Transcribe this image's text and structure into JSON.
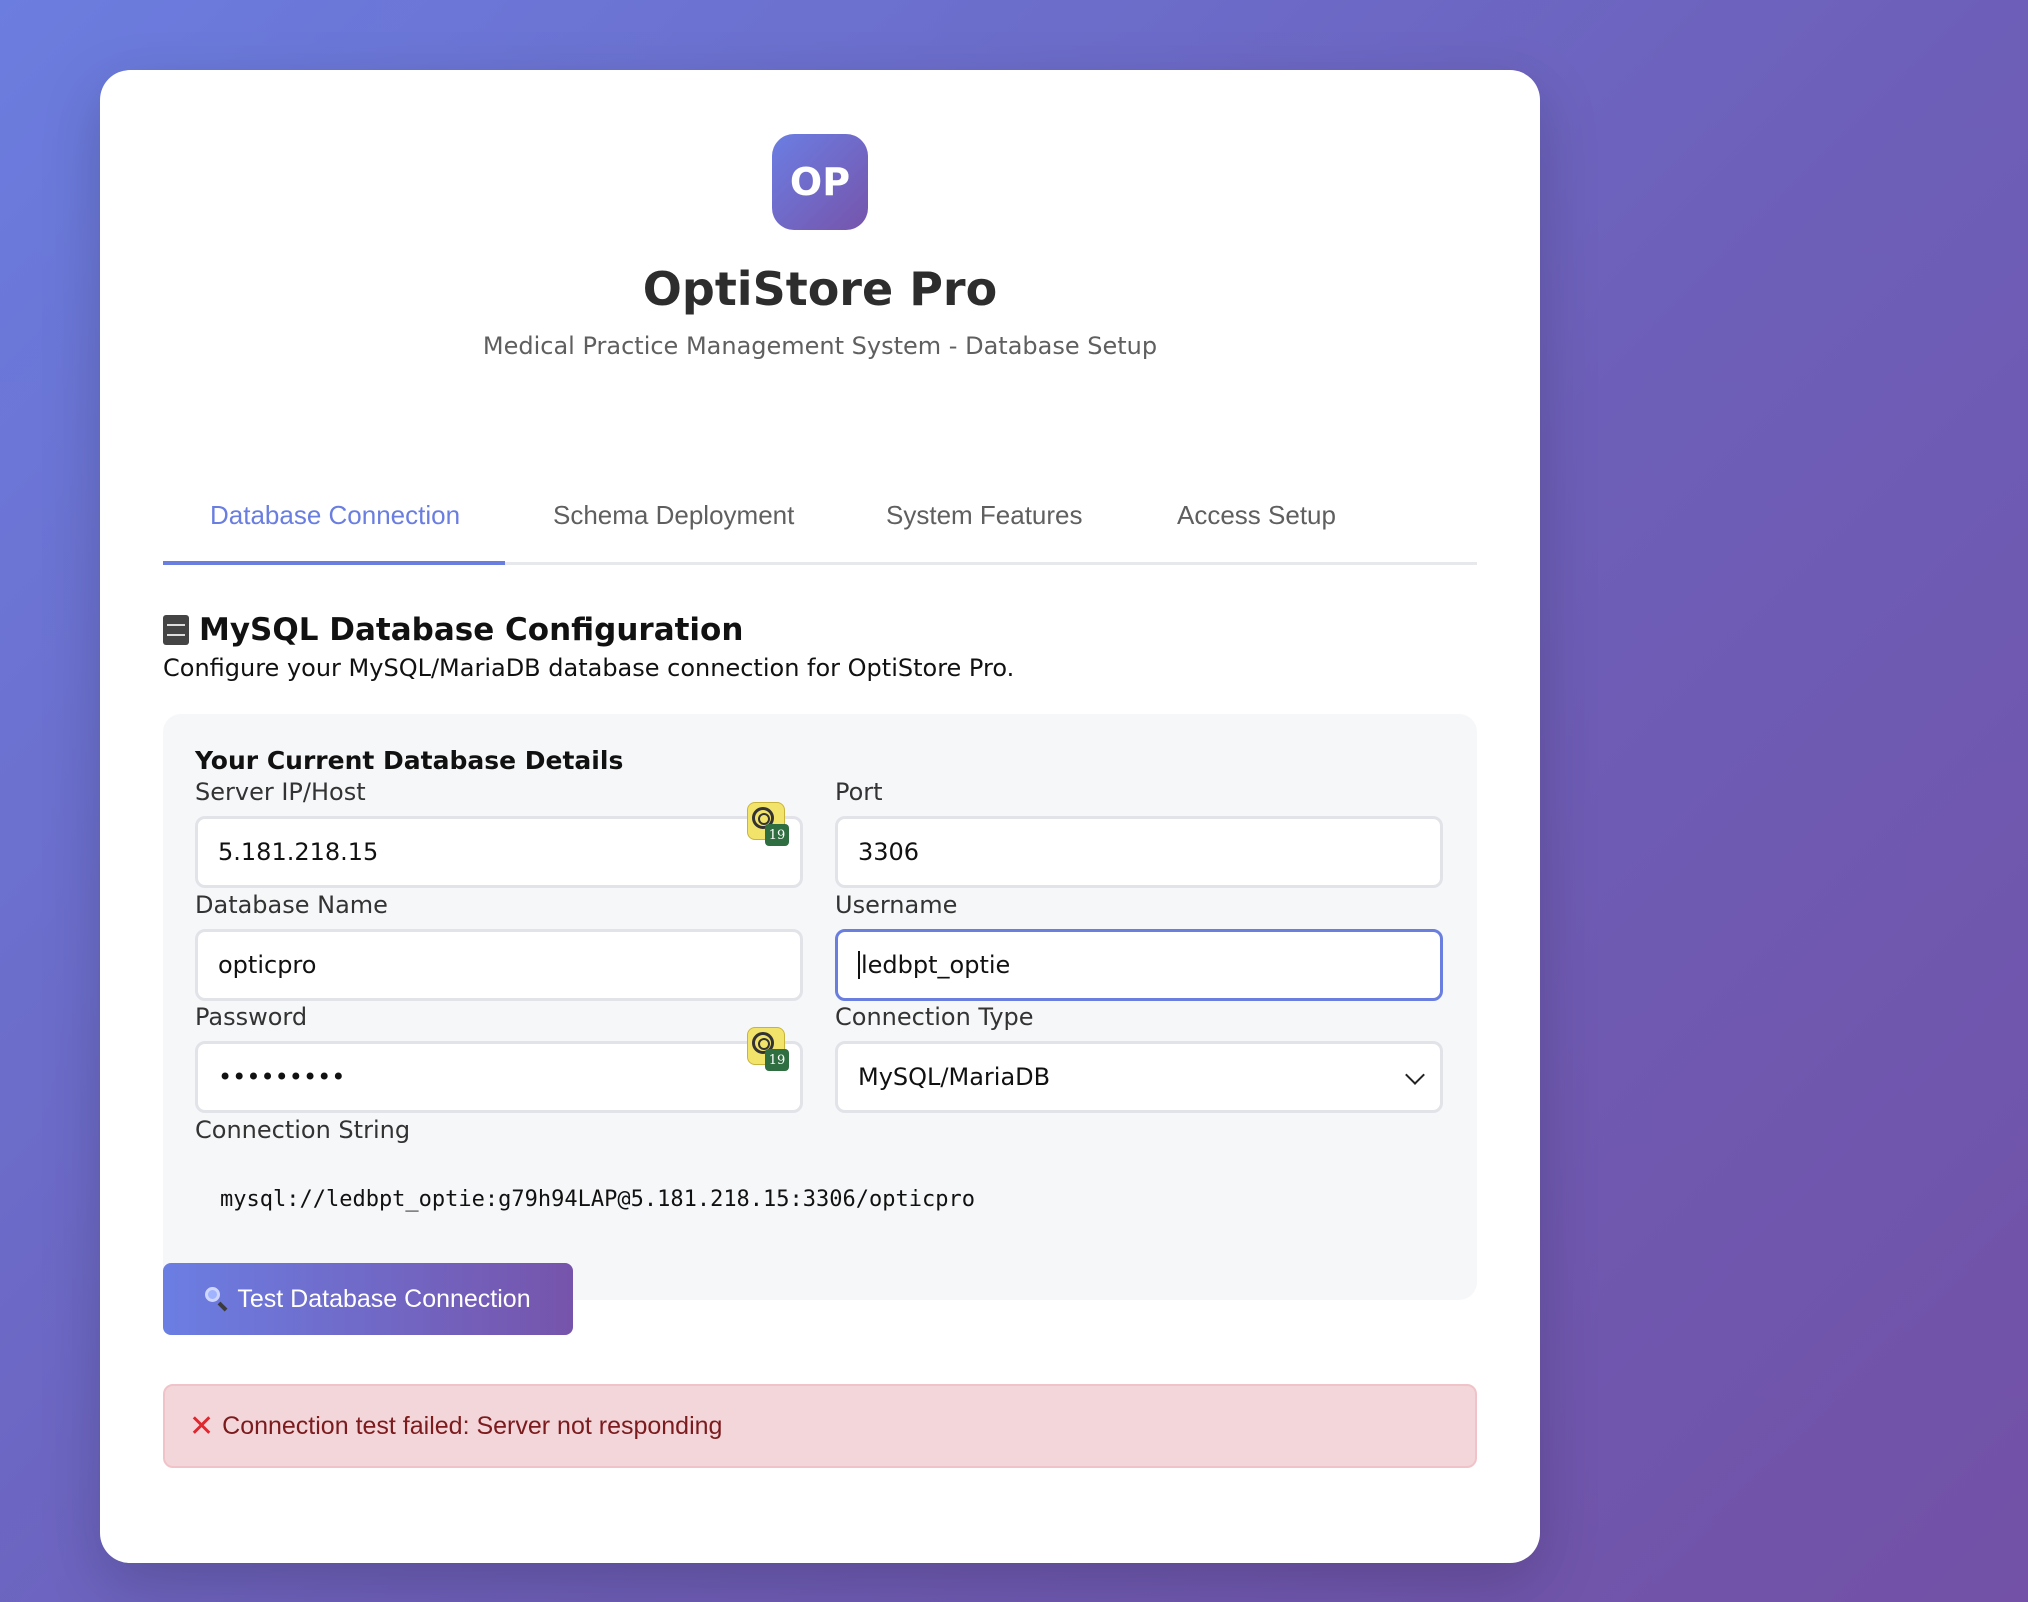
{
  "app": {
    "logo_text": "OP",
    "title": "OptiStore Pro",
    "subtitle": "Medical Practice Management System - Database Setup"
  },
  "tabs": [
    {
      "label": "Database Connection",
      "active": true
    },
    {
      "label": "Schema Deployment",
      "active": false
    },
    {
      "label": "System Features",
      "active": false
    },
    {
      "label": "Access Setup",
      "active": false
    }
  ],
  "section": {
    "icon": "file-cabinet-icon",
    "title": "MySQL Database Configuration",
    "description": "Configure your MySQL/MariaDB database connection for OptiStore Pro."
  },
  "panel": {
    "title": "Your Current Database Details",
    "fields": {
      "server": {
        "label": "Server IP/Host",
        "value": "5.181.218.15"
      },
      "port": {
        "label": "Port",
        "value": "3306"
      },
      "database": {
        "label": "Database Name",
        "value": "opticpro"
      },
      "username": {
        "label": "Username",
        "value": "ledbpt_optie"
      },
      "password": {
        "label": "Password",
        "value": "•••••••••"
      },
      "connection_type": {
        "label": "Connection Type",
        "value": "MySQL/MariaDB"
      }
    },
    "password_manager_badge_count": "19",
    "connection_string_label": "Connection String",
    "connection_string": "mysql://ledbpt_optie:g79h94LAP@5.181.218.15:3306/opticpro"
  },
  "test_button": {
    "icon": "magnifier-icon",
    "label": "Test Database Connection"
  },
  "alert": {
    "icon": "x-icon",
    "message": "Connection test failed: Server not responding"
  },
  "colors": {
    "accent": "#6a7ee0",
    "gradient_start": "#6b7ee3",
    "gradient_end": "#7654ab",
    "error_bg": "#f3d6d9",
    "error_text": "#7b1b1e"
  }
}
